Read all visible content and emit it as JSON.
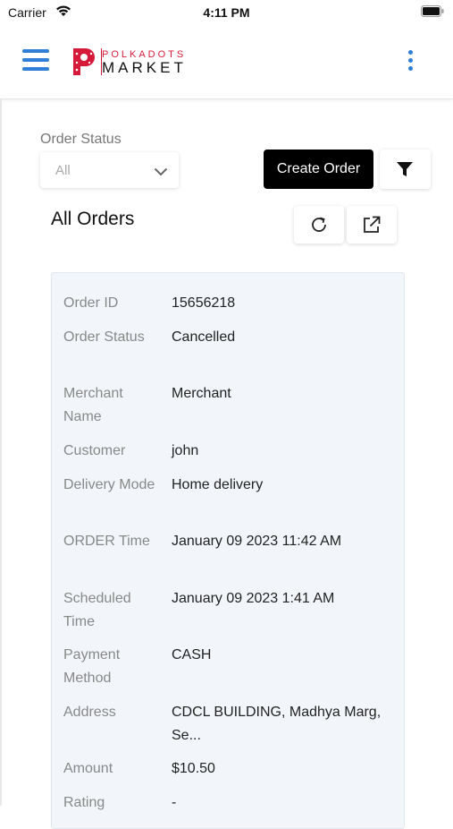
{
  "status_bar": {
    "carrier": "Carrier",
    "time": "4:11 PM"
  },
  "header": {
    "logo_top": "POLKADOTS",
    "logo_bottom": "MARKET",
    "brand_color": "#d71a3a",
    "accent_color": "#2f7ed8"
  },
  "filters": {
    "order_status_label": "Order Status",
    "order_status_value": "All",
    "create_order_label": "Create Order"
  },
  "orders": {
    "title": "All Orders",
    "card": [
      {
        "label": "Order ID",
        "value": "15656218"
      },
      {
        "label": "Order Status",
        "value": "Cancelled"
      },
      {
        "label": "Merchant Name",
        "value": "Merchant"
      },
      {
        "label": "Customer",
        "value": "john"
      },
      {
        "label": "Delivery Mode",
        "value": "Home delivery"
      },
      {
        "label": "ORDER Time",
        "value": "January 09 2023 11:42 AM"
      },
      {
        "label": "Scheduled Time",
        "value": "January 09 2023 1:41 AM"
      },
      {
        "label": "Payment Method",
        "value": "CASH"
      },
      {
        "label": "Address",
        "value": "CDCL BUILDING, Madhya Marg, Se..."
      },
      {
        "label": "Amount",
        "value": "$10.50"
      },
      {
        "label": "Rating",
        "value": "-"
      }
    ]
  }
}
